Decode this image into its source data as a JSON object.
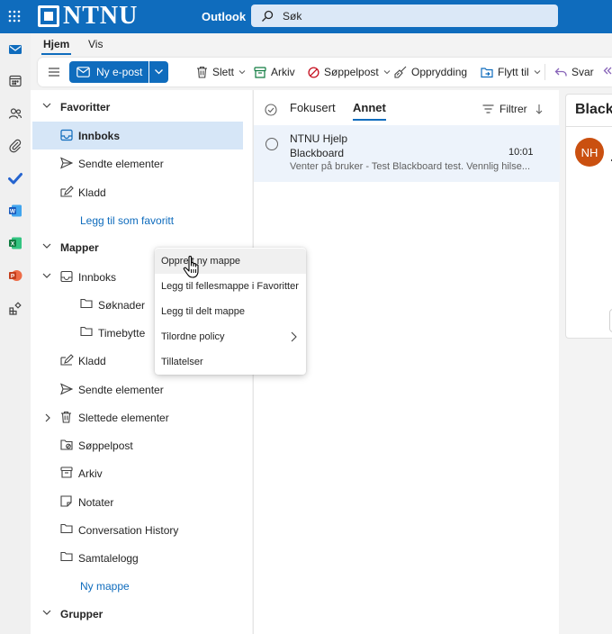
{
  "topbar": {
    "brand": "NTNU",
    "app_name": "Outlook",
    "search_placeholder": "Søk",
    "icons": [
      "app-launcher-icon",
      "search-icon"
    ]
  },
  "rail": {
    "icons": [
      "mail-icon",
      "calendar-icon",
      "people-icon",
      "attachment-icon",
      "todo-icon",
      "word-icon",
      "excel-icon",
      "powerpoint-icon",
      "apps-icon"
    ]
  },
  "ribbon": {
    "tabs": [
      "Hjem",
      "Vis"
    ],
    "active_tab": "Hjem",
    "new_mail": "Ny e-post",
    "buttons": [
      "Slett",
      "Arkiv",
      "Søppelpost",
      "Opprydding",
      "Flytt til",
      "Svar"
    ]
  },
  "folders": {
    "favorites_header": "Favoritter",
    "favorites": [
      "Innboks",
      "Sendte elementer",
      "Kladd"
    ],
    "add_favorite": "Legg til som favoritt",
    "folders_header": "Mapper",
    "items": [
      "Innboks",
      "Søknader",
      "Timebytte",
      "Kladd",
      "Sendte elementer",
      "Slettede elementer",
      "Søppelpost",
      "Arkiv",
      "Notater",
      "Conversation History",
      "Samtalelogg"
    ],
    "new_folder": "Ny mappe",
    "groups_header": "Grupper",
    "selected": "Innboks"
  },
  "message_list": {
    "tabs": [
      "Fokusert",
      "Annet"
    ],
    "active_tab": "Annet",
    "filter": "Filtrer",
    "messages": [
      {
        "from": "NTNU Hjelp",
        "subject": "Blackboard",
        "time": "10:01",
        "preview": "Venter på bruker - Test Blackboard test. Vennlig hilse..."
      }
    ]
  },
  "reading_pane": {
    "title": "Blackb",
    "avatar_initials": "NH",
    "avatar_color": "#ca5010"
  },
  "context_menu": {
    "items": [
      "Opprett ny mappe",
      "Legg til fellesmappe i Favoritter",
      "Legg til delt mappe",
      "Tilordne policy",
      "Tillatelser"
    ],
    "hovered": "Opprett ny mappe"
  },
  "colors": {
    "accent": "#0f6cbd",
    "selected_bg": "#d6e6f7"
  }
}
